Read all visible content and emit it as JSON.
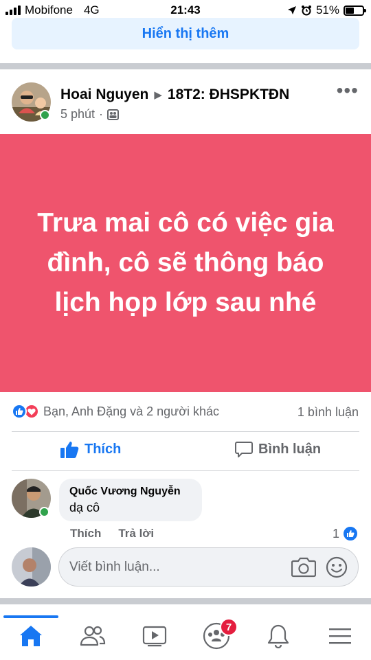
{
  "status_bar": {
    "carrier": "Mobifone",
    "network": "4G",
    "time": "21:43",
    "battery_percent_text": "51%",
    "battery_level": 0.51
  },
  "feed": {
    "show_more_label": "Hiển thị thêm"
  },
  "post": {
    "author": "Hoai Nguyen",
    "group": "18T2: ĐHSPKTĐN",
    "time": "5 phút",
    "time_separator": "·",
    "more_label": "•••",
    "text": "Trưa mai cô có việc gia đình, cô sẽ thông báo lịch họp lớp sau nhé",
    "card_color": "#ef546d",
    "reactions_summary": "Bạn, Anh Đặng và 2 người khác",
    "comment_count": "1 bình luận",
    "like_label": "Thích",
    "comment_label": "Bình luận"
  },
  "comment": {
    "author": "Quốc Vương Nguyễn",
    "text": "dạ cô",
    "like_label": "Thích",
    "reply_label": "Trả lời",
    "like_count": "1"
  },
  "composer": {
    "placeholder": "Viết bình luận..."
  },
  "nav": {
    "items": [
      "home-icon",
      "friends-icon",
      "watch-icon",
      "groups-icon",
      "notifications-icon",
      "menu-icon"
    ],
    "groups_badge": "7"
  },
  "colors": {
    "accent": "#1877f2",
    "online": "#31a24c",
    "badge": "#e41e3f"
  }
}
